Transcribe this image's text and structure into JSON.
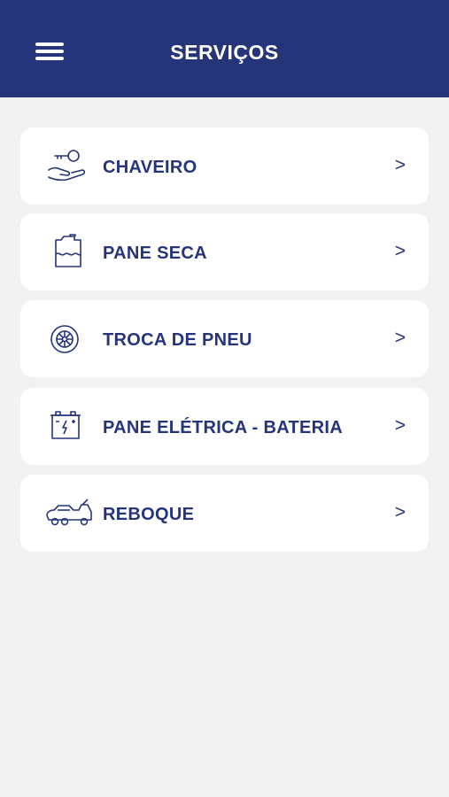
{
  "header": {
    "title": "SERVIÇOS",
    "menu_icon": "hamburger-menu-icon",
    "background": "#263479"
  },
  "accent_color": "#263479",
  "services": [
    {
      "label": "CHAVEIRO",
      "icon": "key-hand-icon",
      "chevron": ">"
    },
    {
      "label": "PANE SECA",
      "icon": "fuel-can-icon",
      "chevron": ">"
    },
    {
      "label": "TROCA DE PNEU",
      "icon": "tire-icon",
      "chevron": ">"
    },
    {
      "label": "PANE ELÉTRICA - BATERIA",
      "icon": "battery-icon",
      "chevron": ">"
    },
    {
      "label": "REBOQUE",
      "icon": "tow-truck-icon",
      "chevron": ">"
    }
  ]
}
